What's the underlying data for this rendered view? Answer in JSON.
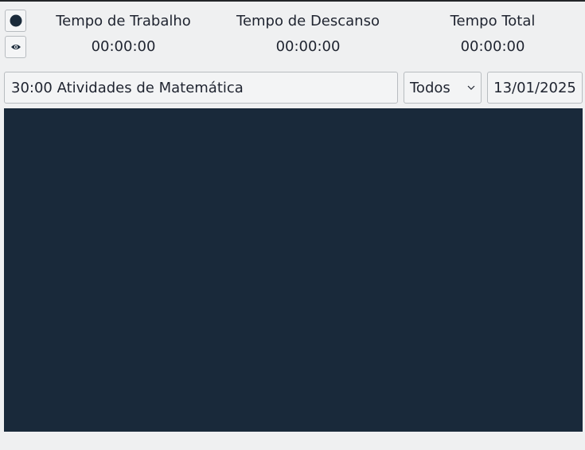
{
  "timers": {
    "work_label": "Tempo de Trabalho",
    "work_value": "00:00:00",
    "rest_label": "Tempo de Descanso",
    "rest_value": "00:00:00",
    "total_label": "Tempo Total",
    "total_value": "00:00:00"
  },
  "toolbar": {
    "record_icon": "record-dot-icon",
    "view_icon": "eye-icon"
  },
  "activity": {
    "value": "30:00 Atividades de Matemática"
  },
  "filter": {
    "selected": "Todos",
    "icon": "chevron-down-icon"
  },
  "date": {
    "value": "13/01/2025"
  },
  "colors": {
    "panel": "#19293a",
    "background": "#eff0f1",
    "text": "#1f2430"
  }
}
